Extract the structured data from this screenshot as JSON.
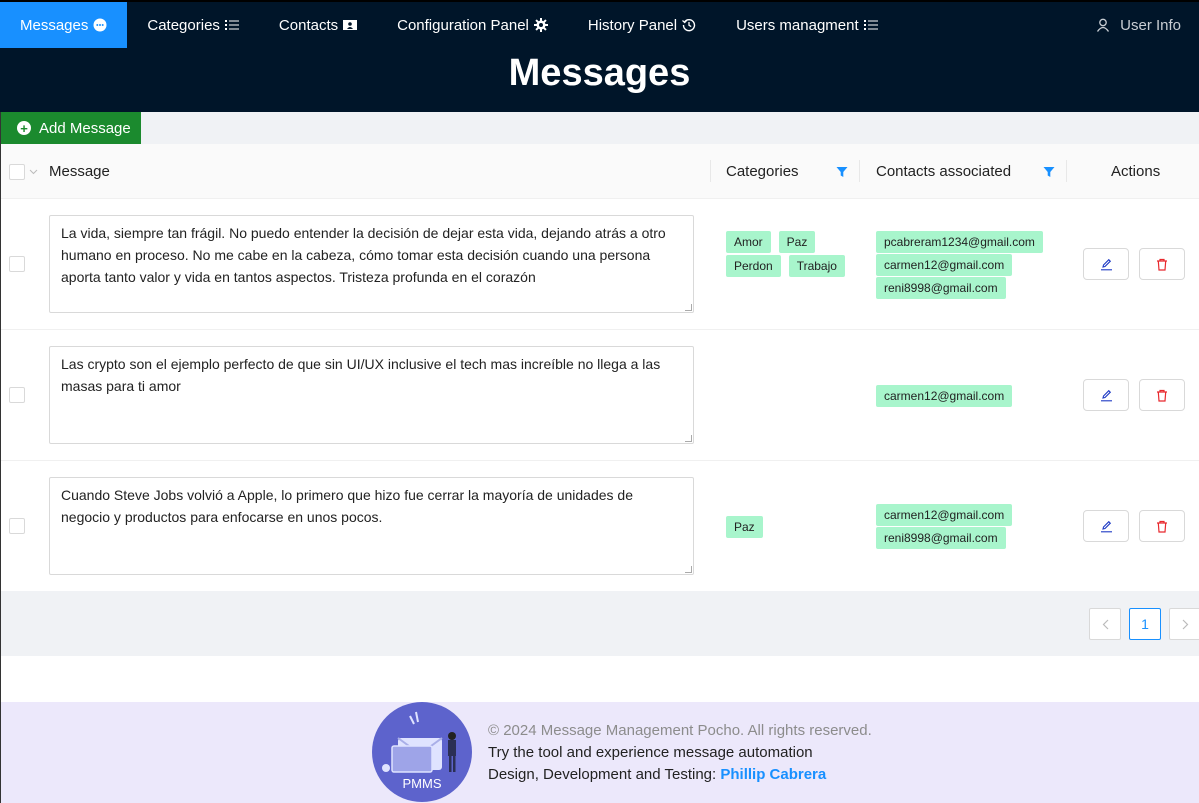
{
  "nav": {
    "items": [
      {
        "label": "Messages",
        "icon": "chat-bubble-icon",
        "active": true
      },
      {
        "label": "Categories",
        "icon": "list-icon",
        "active": false
      },
      {
        "label": "Contacts",
        "icon": "contact-card-icon",
        "active": false
      },
      {
        "label": "Configuration Panel",
        "icon": "gear-icon",
        "active": false
      },
      {
        "label": "History Panel",
        "icon": "history-clock-icon",
        "active": false
      },
      {
        "label": "Users managment",
        "icon": "list-icon",
        "active": false
      }
    ],
    "user_info": "User Info"
  },
  "page": {
    "title": "Messages"
  },
  "toolbar": {
    "add_label": "Add Message"
  },
  "table": {
    "headers": {
      "message": "Message",
      "categories": "Categories",
      "contacts": "Contacts associated",
      "actions": "Actions"
    },
    "rows": [
      {
        "message": "La vida, siempre tan frágil. No puedo entender la decisión de dejar esta vida, dejando atrás a otro humano en proceso. No me cabe en la cabeza, cómo tomar esta decisión cuando una persona aporta tanto valor y vida en tantos aspectos. Tristeza profunda en el corazón",
        "categories": [
          "Amor",
          "Paz",
          "Perdon",
          "Trabajo"
        ],
        "contacts": [
          "pcabreram1234@gmail.com",
          "carmen12@gmail.com",
          "reni8998@gmail.com"
        ]
      },
      {
        "message": "Las crypto son el ejemplo perfecto de que sin UI/UX inclusive el tech mas increíble no llega a las masas para ti amor",
        "categories": [],
        "contacts": [
          "carmen12@gmail.com"
        ]
      },
      {
        "message": "Cuando Steve Jobs volvió a Apple, lo primero que hizo fue cerrar la mayoría de unidades de negocio y productos para enfocarse en unos pocos.",
        "categories": [
          "Paz"
        ],
        "contacts": [
          "carmen12@gmail.com",
          "reni8998@gmail.com"
        ]
      }
    ]
  },
  "pagination": {
    "current": "1"
  },
  "footer": {
    "logo_text": "PMMS",
    "copyright": "© 2024 Message Management Pocho. All rights reserved.",
    "tagline": "Try the tool and experience message automation",
    "credits_prefix": "Design, Development and Testing: ",
    "credits_name": "Phillip Cabrera"
  },
  "colors": {
    "header_bg": "#001529",
    "active_nav": "#1890ff",
    "add_button": "#1b8a2e",
    "tag_bg": "#a8f5cc",
    "delete_icon": "#e8282d",
    "edit_icon": "#1d39c4",
    "footer_bg": "#ece8fb",
    "logo_bg": "#5d63cc"
  }
}
